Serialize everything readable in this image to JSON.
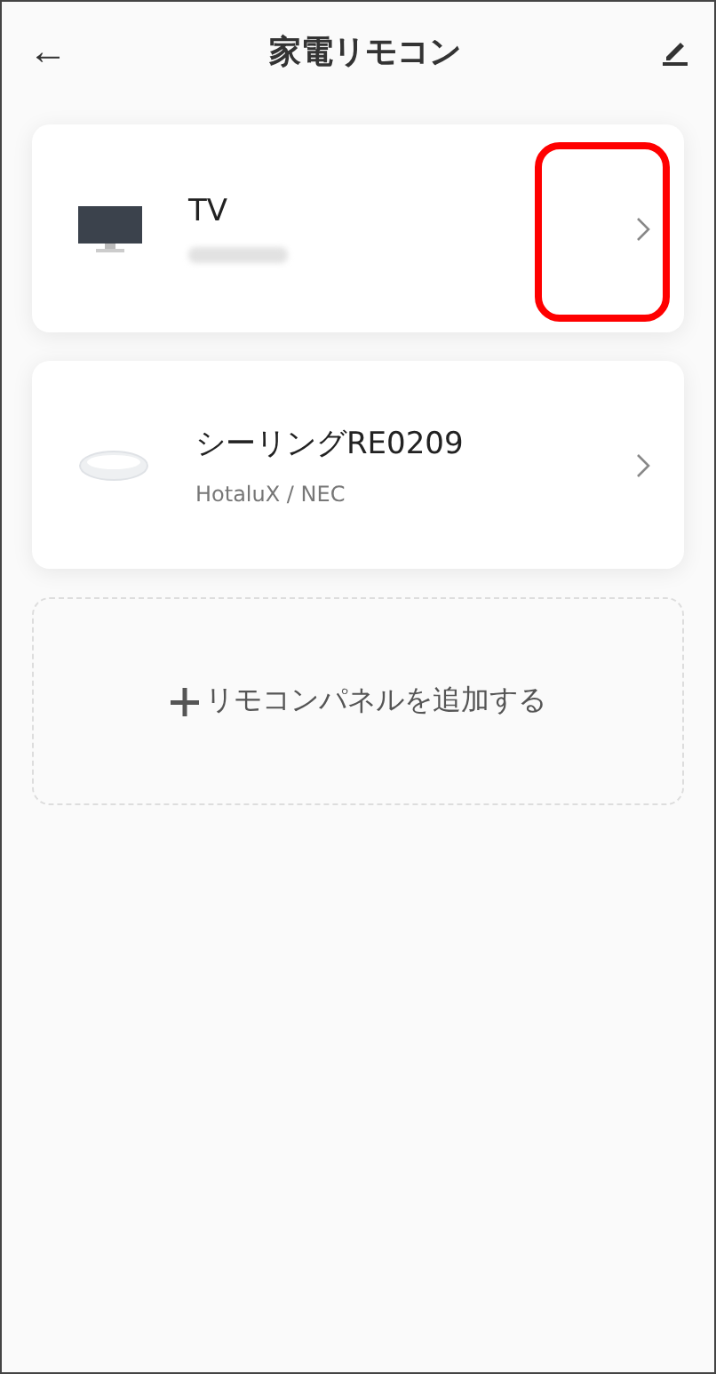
{
  "header": {
    "title": "家電リモコン",
    "back": "←"
  },
  "devices": [
    {
      "kind": "tv",
      "name": "TV",
      "maker_redacted": true,
      "highlighted": true
    },
    {
      "kind": "ceiling_light",
      "name": "シーリングRE0209",
      "maker": "HotaluX / NEC",
      "maker_redacted": false,
      "highlighted": false
    }
  ],
  "add_panel": {
    "label": "リモコンパネルを追加する"
  }
}
